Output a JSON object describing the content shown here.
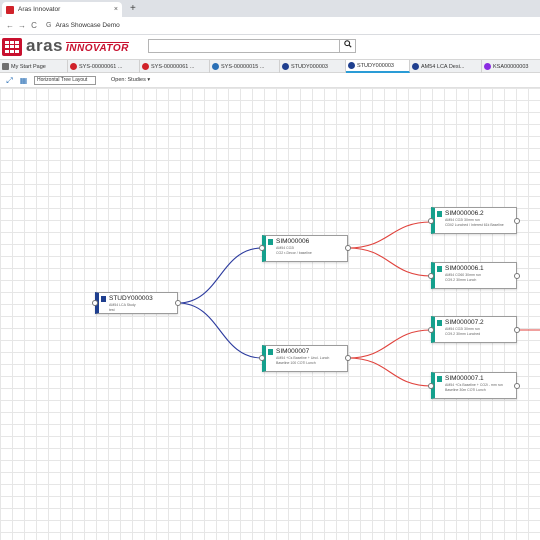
{
  "browser": {
    "tab_title": "Aras Innovator",
    "tab_close": "×",
    "new_tab": "+",
    "url": "Aras Showcase Demo",
    "nav_back": "←",
    "nav_forward": "→",
    "nav_reload": "C"
  },
  "header": {
    "logo_aras": "aras",
    "logo_innovator": "INNOVATOR",
    "search_placeholder": "",
    "search_icon": "search-icon"
  },
  "tabs": [
    {
      "label": "My Start Page",
      "icon_color": "#6f6f6f"
    },
    {
      "label": "SYS-00000061 ...",
      "icon_color": "#d0222a"
    },
    {
      "label": "SYS-00000061 ...",
      "icon_color": "#d0222a"
    },
    {
      "label": "SYS-00000015 ...",
      "icon_color": "#2a6fb5"
    },
    {
      "label": "STUDY000003",
      "icon_color": "#1f3f8f"
    },
    {
      "label": "STUDY000003",
      "icon_color": "#1f3f8f"
    },
    {
      "label": "AM54 LCA Desi...",
      "icon_color": "#1f3f8f"
    },
    {
      "label": "KSA00000003",
      "icon_color": "#8a2be2"
    }
  ],
  "toolbar": {
    "layout_value": "Horizontal Tree Layout",
    "open_label": "Open: Studies ▾"
  },
  "nodes": {
    "study": {
      "title": "STUDY000003",
      "sub1": "AM54 LCA Study",
      "sub2": "test"
    },
    "sim6": {
      "title": "SIM000006",
      "sub1": "AM54 CO2i",
      "sub2": "CO2 r-Decor / baseline"
    },
    "sim7": {
      "title": "SIM000007",
      "sub1": "AM54 +Cs Baseline + Uncl. Lunch",
      "sub2": "Baseline 100 COTi Lunch"
    },
    "sim62": {
      "title": "SIM000006.2",
      "sub1": "AM54 CO2i 30mm run",
      "sub2": "CDIi2 Lunched / Interest 61k Baseline"
    },
    "sim61": {
      "title": "SIM000006.1",
      "sub1": "AM54 CO60 30mm run",
      "sub2": "CO9.2 30mm Lunch"
    },
    "sim72": {
      "title": "SIM000007.2",
      "sub1": "AM54 CO2i 30mm run",
      "sub2": "CO9.2 30mm Lunched"
    },
    "sim71": {
      "title": "SIM000007.1",
      "sub1": "AM54 +Cs Baseline + CO2i - mm run",
      "sub2": "Baseline 30m COTi Lunch"
    }
  },
  "colors": {
    "blue_connector": "#2b3a9e",
    "red_connector": "#e0423c",
    "node_accent": "#15a08d",
    "study_accent": "#1f3f8f",
    "brand_red": "#c8102e"
  }
}
